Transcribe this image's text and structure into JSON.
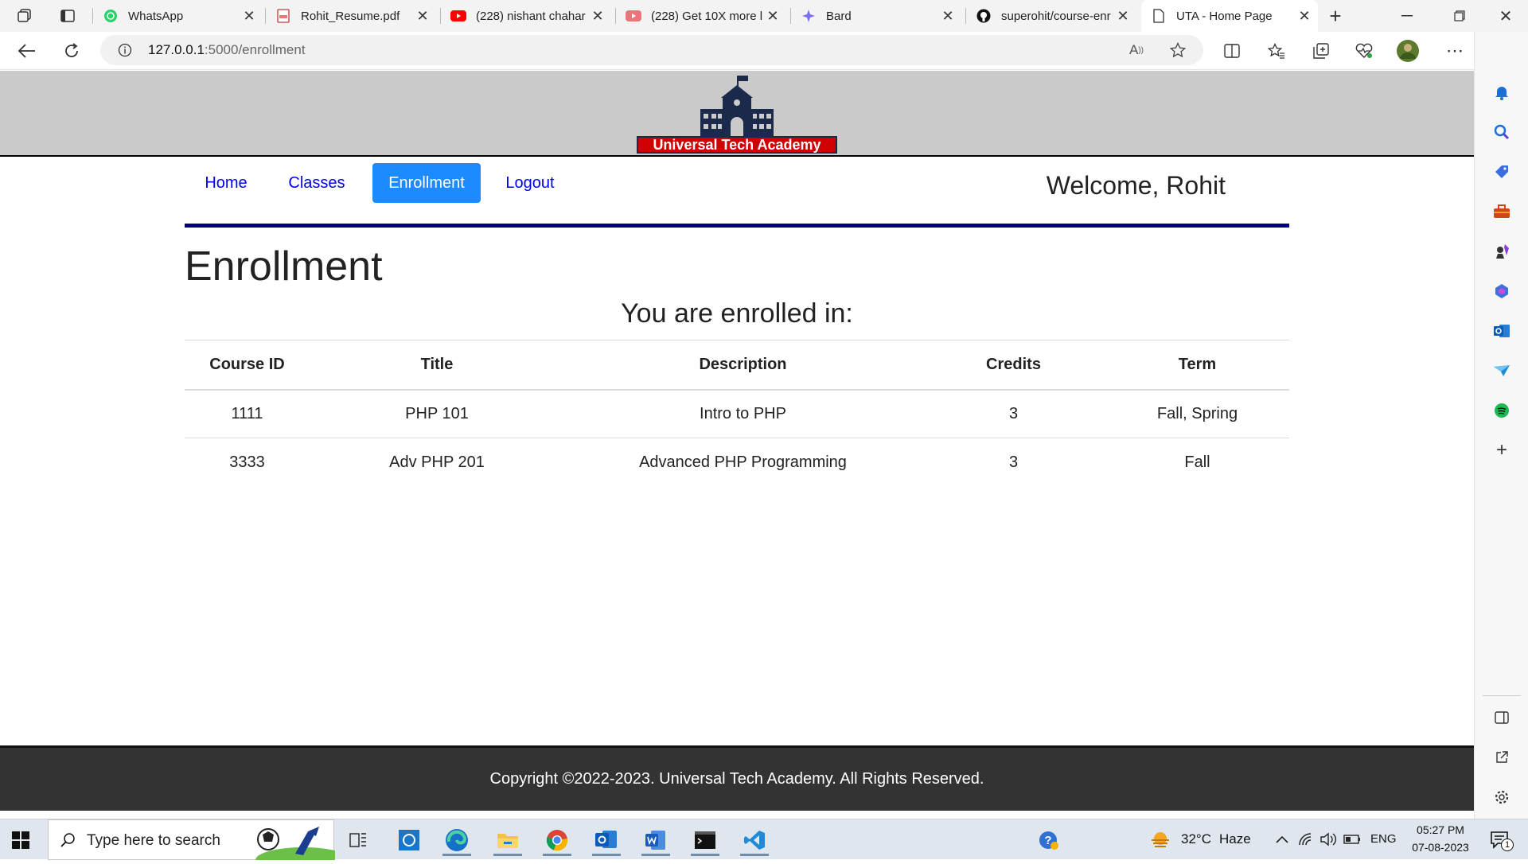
{
  "browser": {
    "tabs": [
      {
        "title": "WhatsApp",
        "icon": "whatsapp-icon"
      },
      {
        "title": "Rohit_Resume.pdf",
        "icon": "pdf-icon"
      },
      {
        "title": "(228) nishant chahar",
        "icon": "youtube-icon"
      },
      {
        "title": "(228) Get 10X more l",
        "icon": "youtube-icon"
      },
      {
        "title": "Bard",
        "icon": "bard-icon"
      },
      {
        "title": "superohit/course-enr",
        "icon": "github-icon"
      },
      {
        "title": "UTA - Home Page",
        "icon": "page-icon"
      }
    ],
    "url_host": "127.0.0.1",
    "url_rest": ":5000/enrollment"
  },
  "site": {
    "logo_text": "Universal Tech Academy",
    "nav": {
      "home": "Home",
      "classes": "Classes",
      "enrollment": "Enrollment",
      "logout": "Logout"
    },
    "welcome": "Welcome, Rohit",
    "title": "Enrollment",
    "subtitle": "You are enrolled in:",
    "table": {
      "headers": [
        "Course ID",
        "Title",
        "Description",
        "Credits",
        "Term"
      ],
      "rows": [
        [
          "1111",
          "PHP 101",
          "Intro to PHP",
          "3",
          "Fall, Spring"
        ],
        [
          "3333",
          "Adv PHP 201",
          "Advanced PHP Programming",
          "3",
          "Fall"
        ]
      ]
    },
    "footer": "Copyright ©2022-2023. Universal Tech Academy. All Rights Reserved."
  },
  "taskbar": {
    "search_placeholder": "Type here to search",
    "weather_temp": "32°C",
    "weather_desc": "Haze",
    "lang": "ENG",
    "time": "05:27 PM",
    "date": "07-08-2023",
    "notification_count": "1"
  },
  "colors": {
    "nav_active": "#1d8bff",
    "rule": "#000080",
    "logo_red": "#d10000",
    "logo_navy": "#1b2a4a"
  }
}
